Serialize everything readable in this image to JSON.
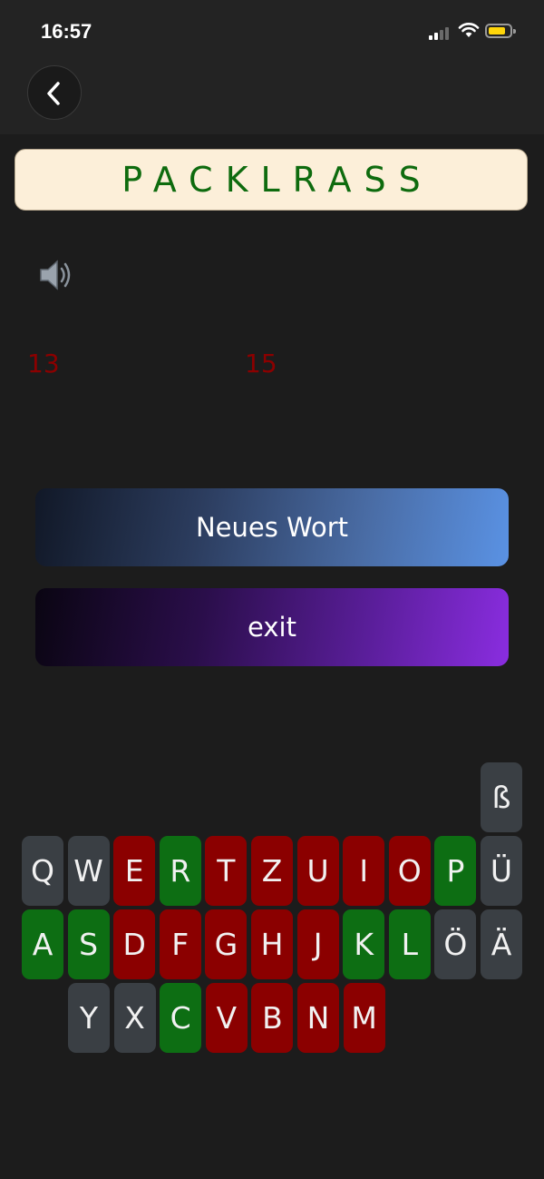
{
  "status_bar": {
    "time": "16:57"
  },
  "word": "PACKLRASS",
  "counts": {
    "left": "13",
    "right": "15"
  },
  "buttons": {
    "new_word": "Neues Wort",
    "exit": "exit"
  },
  "colors": {
    "correct": "#0d6e13",
    "wrong": "#8b0000",
    "unused": "#3a3f44",
    "word_text": "#0e6b0e",
    "word_bg": "#fcefd9"
  },
  "icons": {
    "back": "chevron-left-icon",
    "speaker": "speaker-icon"
  },
  "keyboard": {
    "extra": [
      {
        "label": "ß",
        "state": "unused"
      }
    ],
    "row1": [
      {
        "label": "Q",
        "state": "unused"
      },
      {
        "label": "W",
        "state": "unused"
      },
      {
        "label": "E",
        "state": "wrong"
      },
      {
        "label": "R",
        "state": "correct"
      },
      {
        "label": "T",
        "state": "wrong"
      },
      {
        "label": "Z",
        "state": "wrong"
      },
      {
        "label": "U",
        "state": "wrong"
      },
      {
        "label": "I",
        "state": "wrong"
      },
      {
        "label": "O",
        "state": "wrong"
      },
      {
        "label": "P",
        "state": "correct"
      },
      {
        "label": "Ü",
        "state": "unused"
      }
    ],
    "row2": [
      {
        "label": "A",
        "state": "correct"
      },
      {
        "label": "S",
        "state": "correct"
      },
      {
        "label": "D",
        "state": "wrong"
      },
      {
        "label": "F",
        "state": "wrong"
      },
      {
        "label": "G",
        "state": "wrong"
      },
      {
        "label": "H",
        "state": "wrong"
      },
      {
        "label": "J",
        "state": "wrong"
      },
      {
        "label": "K",
        "state": "correct"
      },
      {
        "label": "L",
        "state": "correct"
      },
      {
        "label": "Ö",
        "state": "unused"
      },
      {
        "label": "Ä",
        "state": "unused"
      }
    ],
    "row3": [
      {
        "label": "Y",
        "state": "unused"
      },
      {
        "label": "X",
        "state": "unused"
      },
      {
        "label": "C",
        "state": "correct"
      },
      {
        "label": "V",
        "state": "wrong"
      },
      {
        "label": "B",
        "state": "wrong"
      },
      {
        "label": "N",
        "state": "wrong"
      },
      {
        "label": "M",
        "state": "wrong"
      }
    ]
  }
}
